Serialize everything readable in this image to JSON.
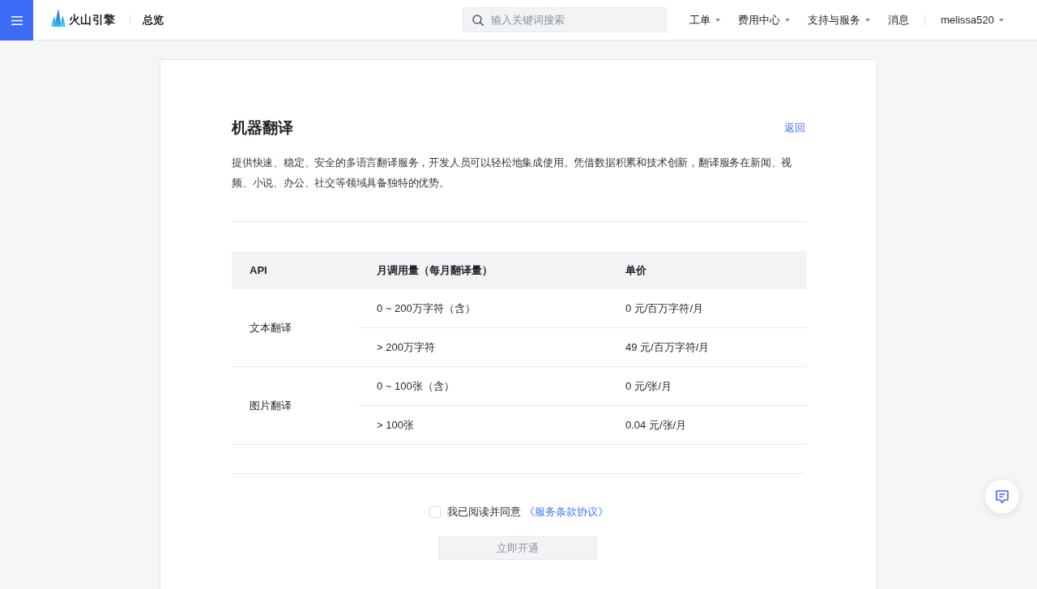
{
  "header": {
    "brand": "火山引擎",
    "section": "总览",
    "search": {
      "placeholder": "输入关键词搜索"
    },
    "nav": [
      {
        "label": "工单",
        "dropdown": true
      },
      {
        "label": "费用中心",
        "dropdown": true
      },
      {
        "label": "支持与服务",
        "dropdown": true
      },
      {
        "label": "消息",
        "dropdown": false
      }
    ],
    "user": {
      "name": "melissa520",
      "dropdown": true
    }
  },
  "product": {
    "title": "机器翻译",
    "back_link": "返回",
    "description": "提供快速、稳定、安全的多语言翻译服务，开发人员可以轻松地集成使用。凭借数据积累和技术创新，翻译服务在新闻、视频、小说、办公、社交等领域具备独特的优势。"
  },
  "table": {
    "columns": [
      "API",
      "月调用量（每月翻译量）",
      "单价"
    ],
    "groups": [
      {
        "api": "文本翻译",
        "tiers": [
          {
            "usage": "0 ~ 200万字符（含）",
            "price": "0 元/百万字符/月"
          },
          {
            "usage": "> 200万字符",
            "price": "49 元/百万字符/月"
          }
        ]
      },
      {
        "api": "图片翻译",
        "tiers": [
          {
            "usage": "0 ~ 100张（含）",
            "price": "0 元/张/月"
          },
          {
            "usage": "> 100张",
            "price": "0.04 元/张/月"
          }
        ]
      }
    ]
  },
  "agreement": {
    "checked": false,
    "text": "我已阅读并同意",
    "link": "《服务条款协议》"
  },
  "submit": {
    "label": "立即开通",
    "disabled": true
  }
}
